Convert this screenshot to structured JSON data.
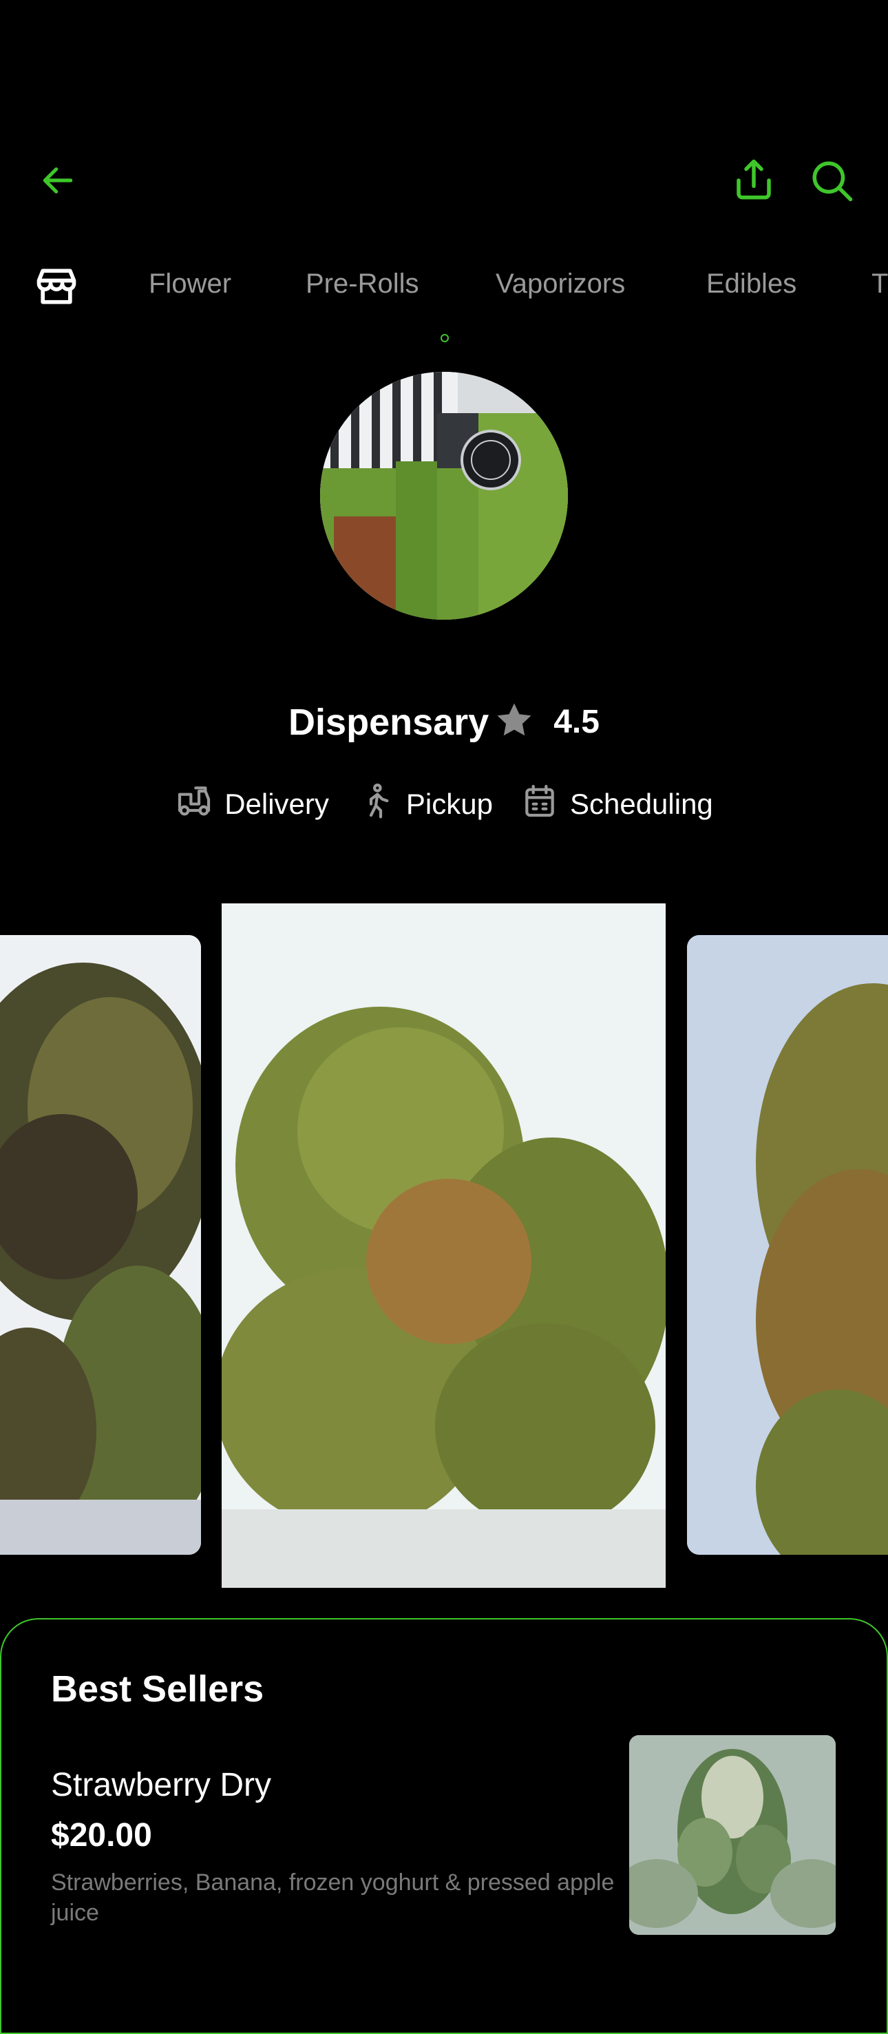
{
  "header": {
    "back_icon": "arrow-left-icon",
    "share_icon": "share-icon",
    "search_icon": "search-icon",
    "accent_color": "#3fc62b"
  },
  "categories": {
    "store_icon": "storefront-icon",
    "items": [
      "Flower",
      "Pre-Rolls",
      "Vaporizors",
      "Edibles",
      "T"
    ]
  },
  "store": {
    "name": "Dispensary",
    "rating": "4.5",
    "rating_icon": "star-icon",
    "services": [
      {
        "icon": "delivery-icon",
        "label": "Delivery"
      },
      {
        "icon": "pickup-icon",
        "label": "Pickup"
      },
      {
        "icon": "calendar-icon",
        "label": "Scheduling"
      }
    ]
  },
  "best_sellers": {
    "title": "Best Sellers",
    "items": [
      {
        "name": "Strawberry Dry",
        "price": "$20.00",
        "description": "Strawberries, Banana, frozen yoghurt & pressed apple juice"
      }
    ]
  }
}
